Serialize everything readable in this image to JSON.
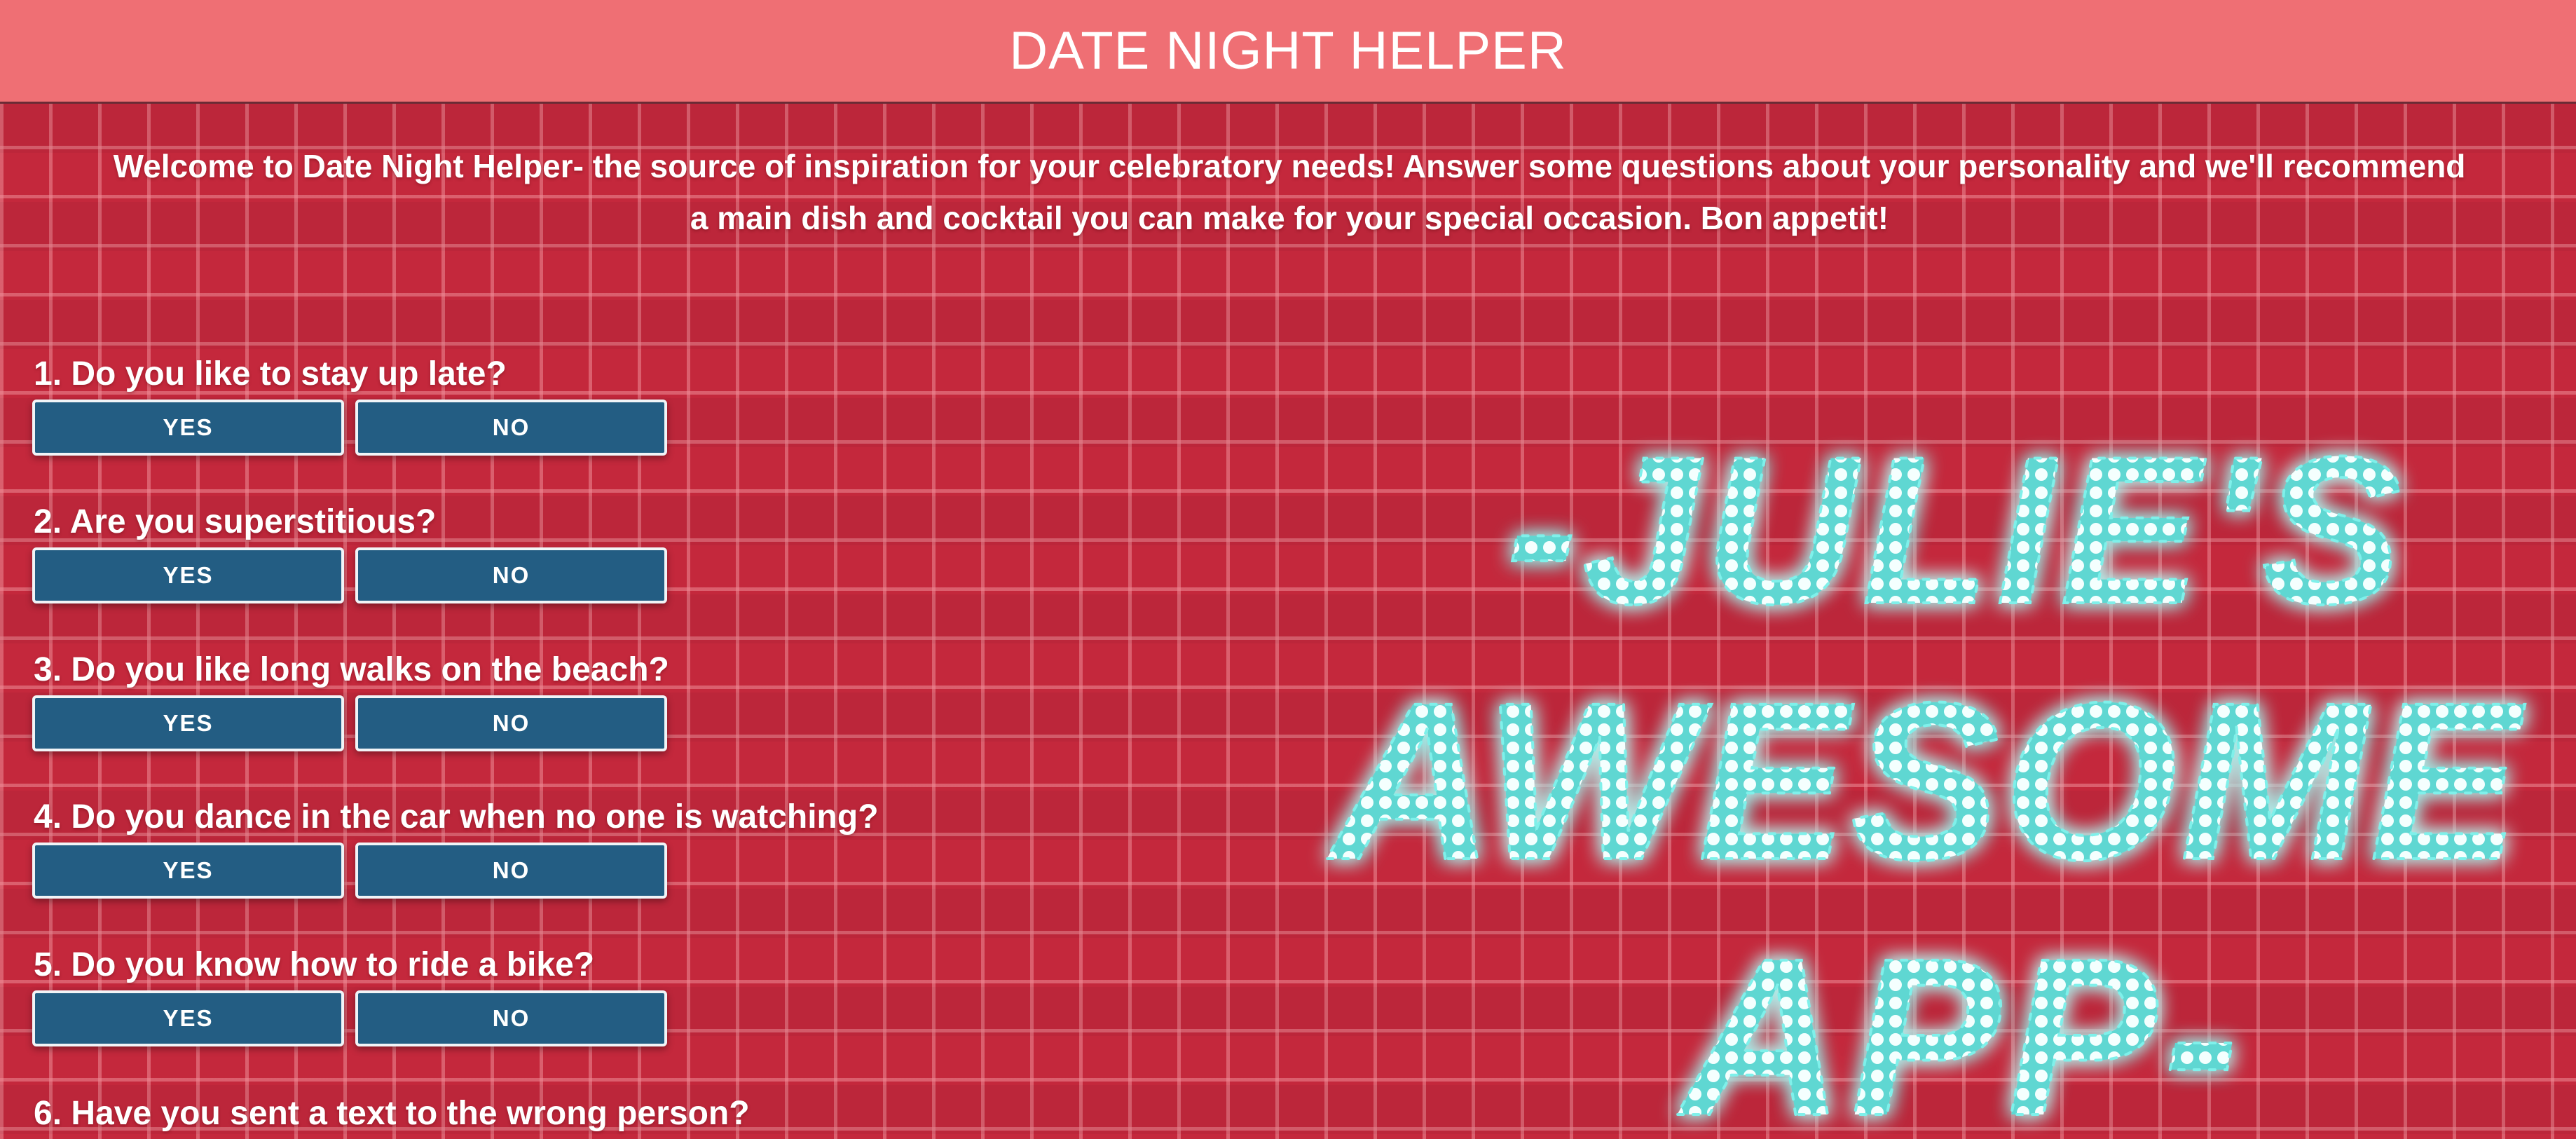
{
  "header": {
    "title": "DATE NIGHT HELPER"
  },
  "intro": {
    "line1": "Welcome to Date Night Helper- the source of inspiration for your celebratory needs! Answer some questions about your personality and we'll recommend",
    "line2": "a main dish and cocktail you can make for your special occasion. Bon appetit!"
  },
  "questions": [
    {
      "text": "1. Do you like to stay up late?",
      "yes": "YES",
      "no": "NO"
    },
    {
      "text": "2. Are you superstitious?",
      "yes": "YES",
      "no": "NO"
    },
    {
      "text": "3. Do you like long walks on the beach?",
      "yes": "YES",
      "no": "NO"
    },
    {
      "text": "4. Do you dance in the car when no one is watching?",
      "yes": "YES",
      "no": "NO"
    },
    {
      "text": "5. Do you know how to ride a bike?",
      "yes": "YES",
      "no": "NO"
    },
    {
      "text": "6. Have you sent a text to the wrong person?"
    }
  ],
  "neon_sign": {
    "line1": "-JULIE'S",
    "line2": "AWESOME",
    "line3": "APP-",
    "color": "#6fe3dd"
  },
  "colors": {
    "header": "#ef6f74",
    "brick": "#c4283c",
    "button": "#235d83"
  }
}
